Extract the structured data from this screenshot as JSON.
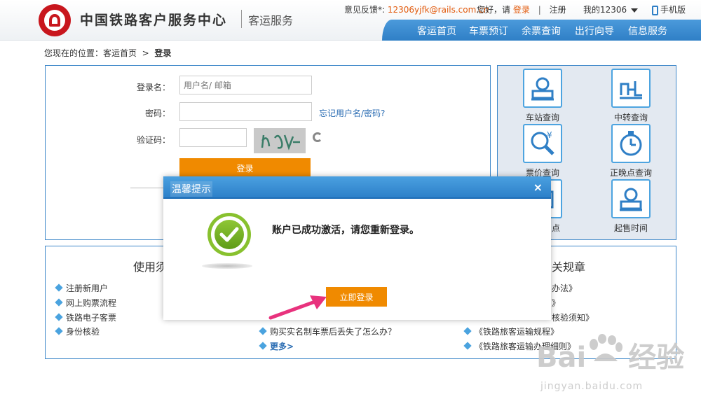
{
  "header": {
    "site_title": "中国铁路客户服务中心",
    "site_subtitle": "客运服务",
    "feedback_label": "意见反馈*:",
    "feedback_email": "12306yjfk@rails.com.cn",
    "greeting": "您好，请",
    "login_link": "登录",
    "separator": "|",
    "register_link": "注册",
    "my_account": "我的12306",
    "mobile": "手机版",
    "colors": {
      "nav": "#2f7fc6",
      "brand": "#c8161d",
      "accent": "#e25a0c"
    }
  },
  "nav": {
    "items": [
      {
        "label": "客运首页"
      },
      {
        "label": "车票预订"
      },
      {
        "label": "余票查询"
      },
      {
        "label": "出行向导"
      },
      {
        "label": "信息服务"
      }
    ]
  },
  "breadcrumb": {
    "prefix": "您现在的位置：",
    "home": "客运首页",
    "arrow": ">",
    "current": "登录"
  },
  "login_form": {
    "username_label": "登录名：",
    "username_placeholder": "用户名/ 邮箱",
    "password_label": "密码：",
    "forgot_link": "忘记用户名/密码?",
    "captcha_label": "验证码：",
    "submit_label": "登录"
  },
  "side_tools": {
    "items": [
      {
        "label": "车站查询",
        "icon": "station-icon"
      },
      {
        "label": "中转查询",
        "icon": "transfer-icon"
      },
      {
        "label": "票价查询",
        "icon": "price-search-icon"
      },
      {
        "label": "正晚点查询",
        "icon": "clock-icon"
      },
      {
        "label": "点",
        "icon": "sale-point-icon"
      },
      {
        "label": "起售时间",
        "icon": "station-icon"
      }
    ]
  },
  "bottom": {
    "left_title": "使用须",
    "left_items": [
      "注册新用户",
      "网上购票流程",
      "铁路电子客票",
      "身份核验"
    ],
    "middle_items": [
      "购买实名制车票后丢失了怎么办？"
    ],
    "more_label": "更多>",
    "right_title": "关规章",
    "right_items": [
      "办法》",
      "》",
      "核验须知》",
      "《铁路旅客运输规程》",
      "《铁路旅客运输办理细则》"
    ]
  },
  "dialog": {
    "title": "温馨提示",
    "close": "×",
    "message": "账户已成功激活，请您重新登录。",
    "confirm_label": "立即登录"
  },
  "watermark": {
    "brand": "Bai",
    "brand_tail": "经验",
    "url": "jingyan.baidu.com"
  }
}
